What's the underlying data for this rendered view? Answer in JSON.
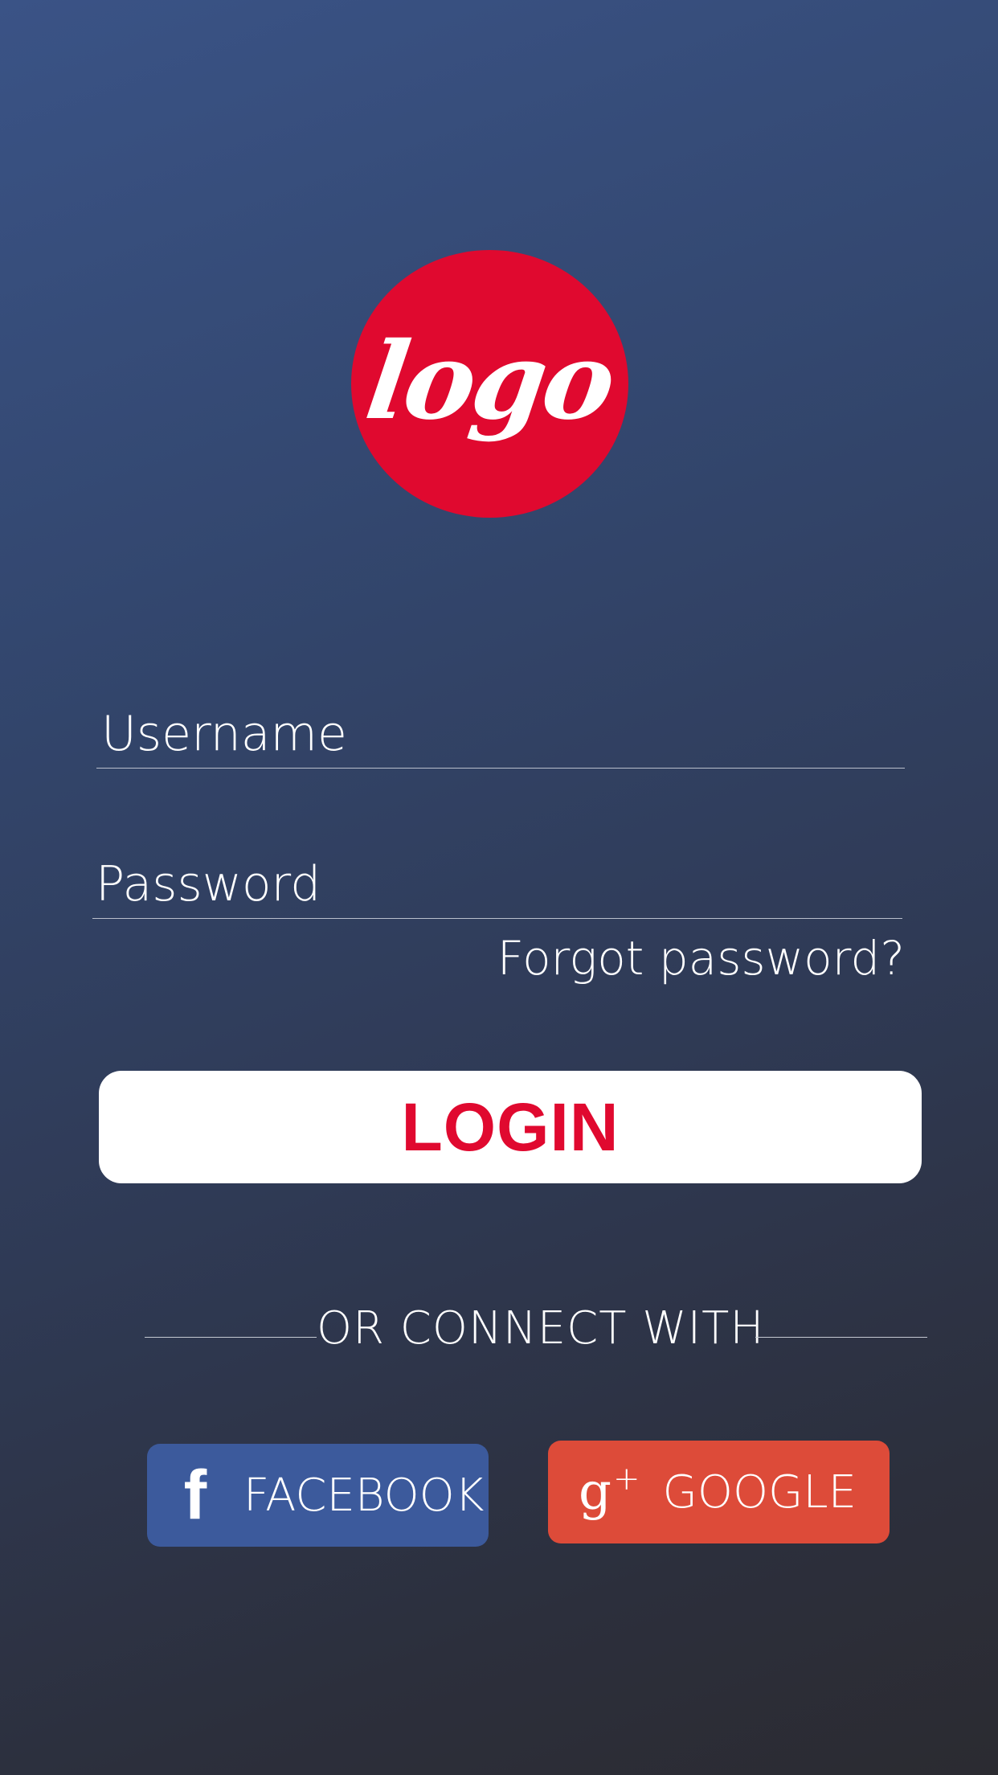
{
  "logo": {
    "text": "logo",
    "color": "#e0092f"
  },
  "form": {
    "username_placeholder": "Username",
    "password_placeholder": "Password",
    "forgot_password": "Forgot password?",
    "login_label": "LOGIN"
  },
  "divider": {
    "text": "OR CONNECT WITH"
  },
  "social": {
    "facebook": {
      "icon": "facebook-icon",
      "glyph": "f",
      "label": "FACEBOOK",
      "color": "#3c5a9c"
    },
    "google": {
      "icon": "google-plus-icon",
      "glyph": "g",
      "plus": "+",
      "label": "GOOGLE",
      "color": "#dd4b39"
    }
  },
  "colors": {
    "background_top": "#3a5386",
    "background_bottom": "#2b2b31",
    "accent": "#e0092f"
  }
}
